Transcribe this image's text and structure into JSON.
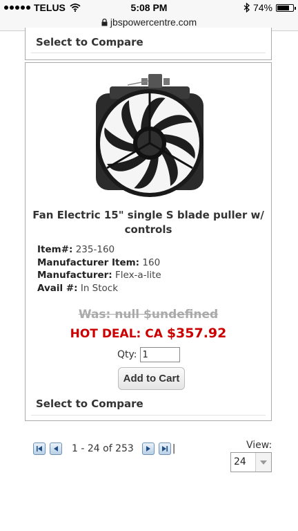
{
  "status_bar": {
    "carrier": "TELUS",
    "time": "5:08 PM",
    "battery": "74%"
  },
  "browser": {
    "url": "jbspowercentre.com"
  },
  "prev_card": {
    "compare_label": "Select to Compare"
  },
  "product": {
    "title": "Fan Electric 15\" single S blade puller w/ controls",
    "specs": [
      {
        "label": "Item#:",
        "value": "235-160"
      },
      {
        "label": "Manufacturer Item:",
        "value": "160"
      },
      {
        "label": "Manufacturer:",
        "value": "Flex-a-lite"
      },
      {
        "label": "Avail #:",
        "value": "In Stock"
      }
    ],
    "was_price": "Was: null $undefined",
    "hot_deal_label": "HOT DEAL: CA",
    "hot_deal_price": "$357.92",
    "qty_label": "Qty:",
    "qty_value": "1",
    "add_to_cart_label": "Add to Cart",
    "compare_label": "Select to Compare"
  },
  "pagination": {
    "range_text": "1 - 24 of 253",
    "view_label": "View:",
    "view_value": "24"
  }
}
